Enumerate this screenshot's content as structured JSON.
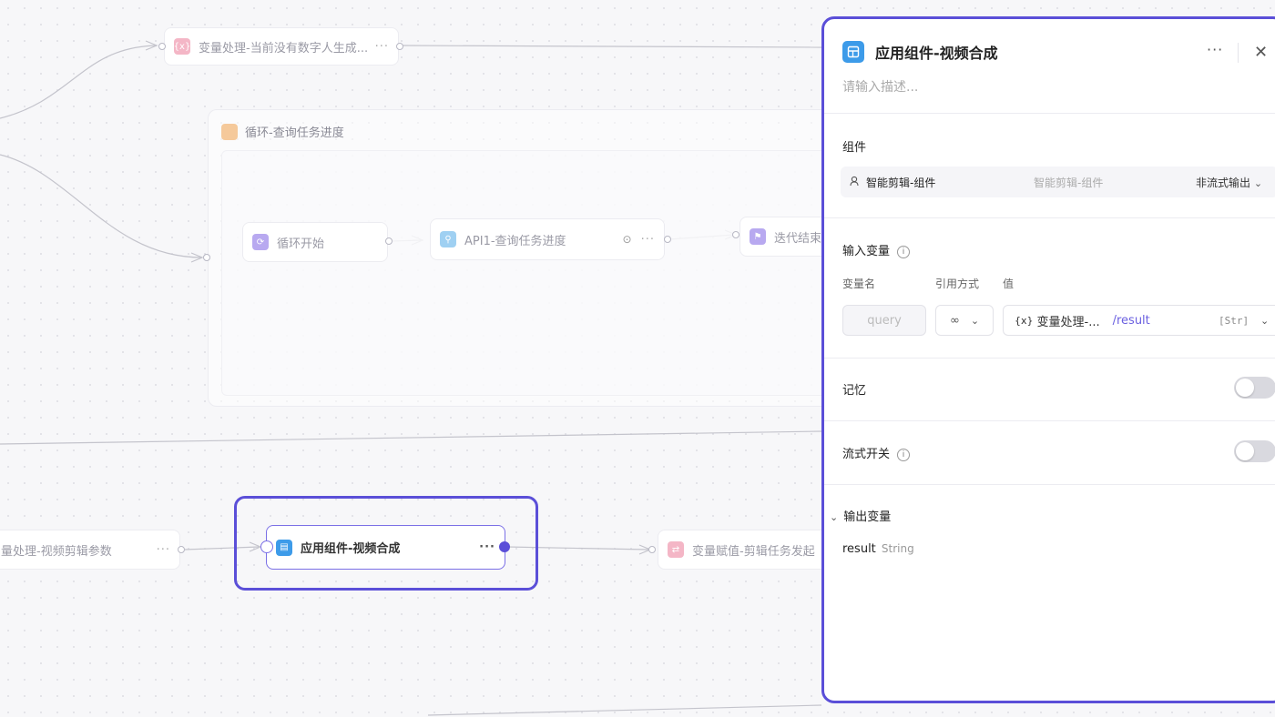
{
  "canvas": {
    "node_var_top": {
      "label": "变量处理-当前没有数字人生成...",
      "icon": "variable-icon",
      "more": "···"
    },
    "loop_group": {
      "title": "循环-查询任务进度",
      "icon": "loop-icon"
    },
    "node_loop_start": {
      "label": "循环开始",
      "icon": "loop-start-icon"
    },
    "node_api": {
      "label": "API1-查询任务进度",
      "icon": "api-icon",
      "more": "···"
    },
    "node_iter_end": {
      "label": "迭代结束",
      "icon": "flag-icon"
    },
    "node_var_left": {
      "label": "量处理-视频剪辑参数",
      "more": "···"
    },
    "node_active": {
      "label": "应用组件-视频合成",
      "icon": "app-component-icon",
      "more": "···"
    },
    "node_assign": {
      "label": "变量赋值-剪辑任务发起",
      "icon": "assign-icon"
    }
  },
  "panel": {
    "title": "应用组件-视频合成",
    "more": "···",
    "close": "✕",
    "description_placeholder": "请输入描述...",
    "component": {
      "section_label": "组件",
      "name": "智能剪辑-组件",
      "subtitle": "智能剪辑-组件",
      "mode": "非流式输出"
    },
    "input_vars": {
      "section_label": "输入变量",
      "col_name": "变量名",
      "col_ref": "引用方式",
      "col_value": "值",
      "row": {
        "name_placeholder": "query",
        "ref_icon": "∞",
        "value_prefix": "{x}",
        "value_source": "变量处理-...",
        "value_path": "/result",
        "value_type": "[Str]"
      }
    },
    "memory": {
      "label": "记忆",
      "enabled": false
    },
    "streaming": {
      "label": "流式开关",
      "enabled": false
    },
    "output_vars": {
      "section_label": "输出变量",
      "name": "result",
      "type": "String"
    }
  },
  "colors": {
    "accent": "#5b4fd8",
    "app_icon": "#3d9be9"
  }
}
